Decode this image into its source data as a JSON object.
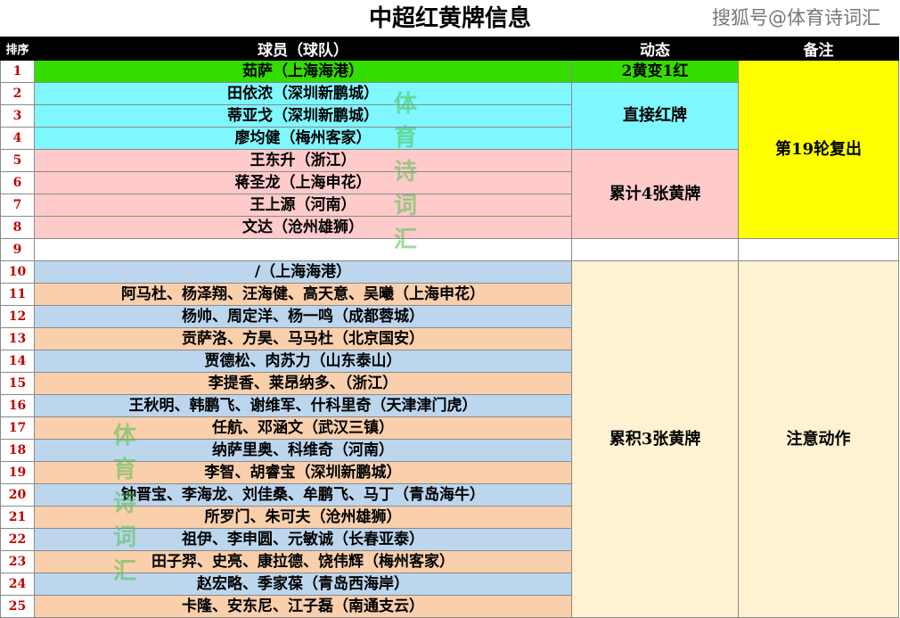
{
  "header": {
    "title": "中超红黄牌信息",
    "brand": "搜狐号@体育诗词汇"
  },
  "columns": [
    "排序",
    "球员（球队）",
    "动态",
    "备注"
  ],
  "rows": [
    {
      "n": "1",
      "player": "茹萨（上海海港）"
    },
    {
      "n": "2",
      "player": "田依浓（深圳新鹏城）"
    },
    {
      "n": "3",
      "player": "蒂亚戈（深圳新鹏城）"
    },
    {
      "n": "4",
      "player": "廖均健（梅州客家）"
    },
    {
      "n": "5",
      "player": "王东升（浙江）"
    },
    {
      "n": "6",
      "player": "蒋圣龙（上海申花）"
    },
    {
      "n": "7",
      "player": "王上源（河南）"
    },
    {
      "n": "8",
      "player": "文达（沧州雄狮）"
    },
    {
      "n": "9",
      "player": ""
    },
    {
      "n": "10",
      "player": "/（上海海港）"
    },
    {
      "n": "11",
      "player": "阿马杜、杨泽翔、汪海健、高天意、吴曦（上海申花）"
    },
    {
      "n": "12",
      "player": "杨帅、周定洋、杨一鸣（成都蓉城）"
    },
    {
      "n": "13",
      "player": "贡萨洛、方昊、马马杜（北京国安）"
    },
    {
      "n": "14",
      "player": "贾德松、肉苏力（山东泰山）"
    },
    {
      "n": "15",
      "player": "李提香、莱昂纳多、（浙江）"
    },
    {
      "n": "16",
      "player": "王秋明、韩鹏飞、谢维军、什科里奇（天津津门虎）"
    },
    {
      "n": "17",
      "player": "任航、邓涵文（武汉三镇）"
    },
    {
      "n": "18",
      "player": "纳萨里奥、科维奇（河南）"
    },
    {
      "n": "19",
      "player": "李智、胡睿宝（深圳新鹏城）"
    },
    {
      "n": "20",
      "player": "钟晋宝、李海龙、刘佳桑、牟鹏飞、马丁（青岛海牛）"
    },
    {
      "n": "21",
      "player": "所罗门、朱可夫（沧州雄狮）"
    },
    {
      "n": "22",
      "player": "祖伊、李申圆、元敏诚（长春亚泰）"
    },
    {
      "n": "23",
      "player": "田子羿、史亮、康拉德、饶伟辉（梅州客家）"
    },
    {
      "n": "24",
      "player": "赵宏略、季家葆（青岛西海岸）"
    },
    {
      "n": "25",
      "player": "卡隆、安东尼、江子磊（南通支云）"
    }
  ],
  "status": {
    "s1": "2黄变1红",
    "s2": "直接红牌",
    "s3": "累计4张黄牌",
    "s4": "累积3张黄牌"
  },
  "remarks": {
    "r1": "第19轮复出",
    "r2": "注意动作"
  },
  "watermark": [
    "体",
    "育",
    "诗",
    "词",
    "汇"
  ],
  "colors": {
    "green": "#33dd00",
    "cyan": "#7ff7ff",
    "pink": "#ffcaca",
    "blue": "#bcd6ee",
    "orange": "#f9cfac",
    "yellow": "#ffff00",
    "cream": "#fff2d2",
    "row_number": "#c00000"
  }
}
